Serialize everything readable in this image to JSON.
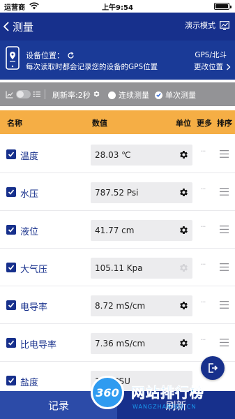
{
  "status_bar": {
    "carrier": "运营商",
    "time": "上午9:54"
  },
  "header": {
    "back_label": "测量",
    "demo_label": "演示模式"
  },
  "location": {
    "label": "设备位置：",
    "note": "每次读取时都会记录您的设备的GPS位置",
    "gps_label": "GPS/北斗",
    "change_label": "更改位置"
  },
  "toolbar": {
    "rate": "刷新率:2秒",
    "continuous_label": "连续测量",
    "single_label": "单次测量",
    "selected_mode": "单次测量",
    "chart_toggle_on": false
  },
  "table": {
    "headers": {
      "name": "名称",
      "value": "数值",
      "unit": "单位",
      "more": "更多",
      "sort": "排序"
    },
    "rows": [
      {
        "name": "温度",
        "value": "28.03 ℃",
        "checked": true,
        "gear_enabled": true
      },
      {
        "name": "水压",
        "value": "787.52 Psi",
        "checked": true,
        "gear_enabled": true
      },
      {
        "name": "液位",
        "value": "41.77 cm",
        "checked": true,
        "gear_enabled": true
      },
      {
        "name": "大气压",
        "value": "105.11 Kpa",
        "checked": true,
        "gear_enabled": false
      },
      {
        "name": "电导率",
        "value": "8.72 mS/cm",
        "checked": true,
        "gear_enabled": true
      },
      {
        "name": "比电导率",
        "value": "7.36 mS/cm",
        "checked": true,
        "gear_enabled": true
      },
      {
        "name": "盐度",
        "value": "1.__ PSU",
        "checked": true,
        "gear_enabled": true
      }
    ]
  },
  "bottom": {
    "record_label": "记录",
    "refresh_label": "刷新"
  },
  "watermark": {
    "badge": "360",
    "title": "网站排行榜",
    "subtitle": "WANGZHAN360.CN"
  },
  "colors": {
    "primary": "#17308c",
    "panel": "#1a3a97",
    "toolbar": "#939396",
    "table_header": "#f5ae45"
  }
}
